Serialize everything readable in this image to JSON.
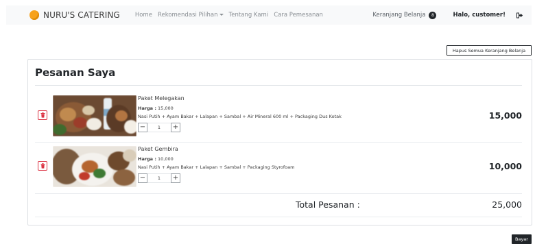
{
  "navbar": {
    "brand": "NURU'S CATERING",
    "links": [
      {
        "label": "Home"
      },
      {
        "label": "Rekomendasi Pilihan"
      },
      {
        "label": "Tentang Kami"
      },
      {
        "label": "Cara Pemesanan"
      }
    ],
    "cart_label": "Keranjang Belanja",
    "cart_count": "8",
    "greeting": "Halo, customer!"
  },
  "clear_all_label": "Hapus Semua Keranjang Belanja",
  "card": {
    "title": "Pesanan Saya",
    "items": [
      {
        "name": "Paket Melegakan",
        "price_label": "Harga :",
        "price": "15,000",
        "description": "Nasi Putih + Ayam Bakar + Lalapan + Sambal + Air Mineral 600 ml + Packaging Dus Kotak",
        "qty": "1",
        "subtotal": "15,000"
      },
      {
        "name": "Paket Gembira",
        "price_label": "Harga :",
        "price": "10,000",
        "description": "Nasi Putih + Ayam Bakar + Lalapan + Sambal + Packaging Styrofoam",
        "qty": "1",
        "subtotal": "10,000"
      }
    ],
    "total_label": "Total Pesanan :",
    "total_value": "25,000"
  },
  "pay_label": "Bayar",
  "colors": {
    "brand_orange": "#f7a21b",
    "delete_red": "#dc3545",
    "dark": "#212529",
    "navbar_bg": "#f8f9fa"
  },
  "icons": {
    "brand": "logo-circle-icon",
    "logout": "sign-out-icon",
    "delete": "trash-icon"
  }
}
